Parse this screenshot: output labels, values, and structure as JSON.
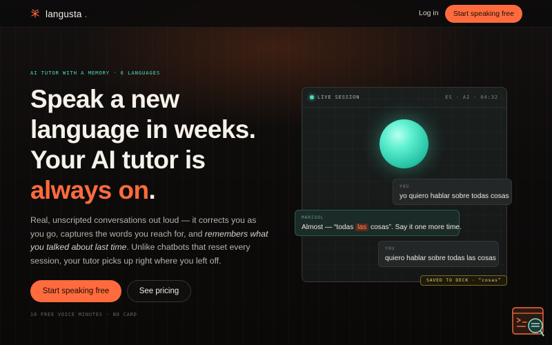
{
  "header": {
    "brand": "langusta",
    "brand_dot": ".",
    "login_label": "Log in",
    "cta_label": "Start speaking free"
  },
  "hero": {
    "eyebrow": "AI TUTOR WITH A MEMORY · 6 LANGUAGES",
    "headline_line1": "Speak a new",
    "headline_line2": "language in weeks.",
    "headline_line3": "Your AI tutor is",
    "headline_accent": "always on",
    "headline_end": ".",
    "lead_part1": "Real, unscripted conversations out loud — it corrects you as you go, captures the words you reach for, and ",
    "lead_emphasis": "remembers what you talked about last time",
    "lead_part2": ". Unlike chatbots that reset every session, your tutor picks up right where you left off.",
    "primary_cta": "Start speaking free",
    "secondary_cta": "See pricing",
    "fine_print": "10 FREE VOICE MINUTES · NO CARD"
  },
  "session": {
    "live_label": "LIVE SESSION",
    "meta": "ES · A2 · 04:32",
    "messages": [
      {
        "speaker": "YOU",
        "text": "yo quiero hablar sobre todas cosas"
      },
      {
        "speaker": "MARISOL",
        "text_before": "Almost — “todas ",
        "highlight": "las",
        "text_after": " cosas”. Say it one more time."
      },
      {
        "speaker": "YOU",
        "text": "quiero hablar sobre todas las cosas"
      }
    ],
    "saved_badge": "SAVED TO DECK · “cosas”"
  },
  "colors": {
    "accent": "#ff6b3d",
    "teal": "#49e0bf",
    "background": "#0b0a09"
  },
  "icons": {
    "logo": "lobster-icon",
    "helper": "chat-helper-icon"
  }
}
